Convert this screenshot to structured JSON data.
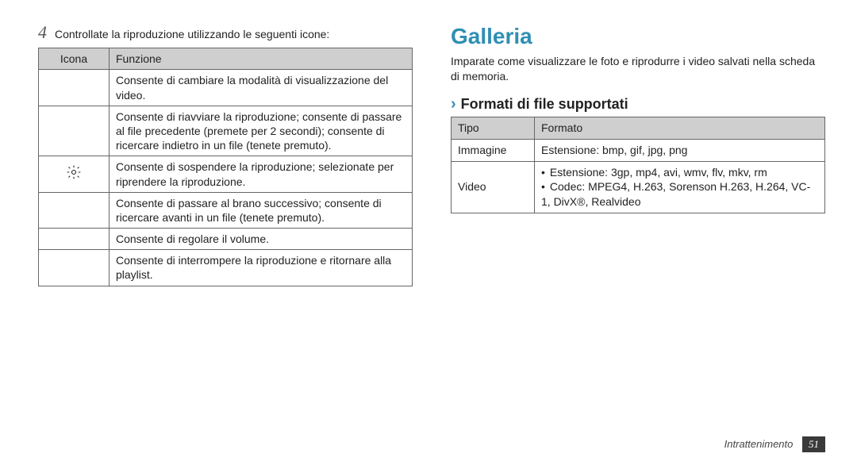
{
  "left": {
    "step_number": "4",
    "step_text": "Controllate la riproduzione utilizzando le seguenti icone:",
    "table": {
      "headers": [
        "Icona",
        "Funzione"
      ],
      "rows": [
        {
          "icon": "",
          "desc": "Consente di cambiare la modalità di visualizzazione del video."
        },
        {
          "icon": "",
          "desc": "Consente di riavviare la riproduzione; consente di passare al file precedente (premete per 2 secondi); consente di ricercare indietro in un file (tenete premuto)."
        },
        {
          "icon": "gear",
          "desc": "Consente di sospendere la riproduzione; selezionate          per riprendere la riproduzione."
        },
        {
          "icon": "",
          "desc": "Consente di passare al brano successivo; consente di ricercare avanti in un file (tenete premuto)."
        },
        {
          "icon": "",
          "desc": "Consente di regolare il volume."
        },
        {
          "icon": "",
          "desc": "Consente di interrompere la riproduzione e ritornare alla playlist."
        }
      ]
    }
  },
  "right": {
    "title": "Galleria",
    "intro": "Imparate come visualizzare le foto e riprodurre i video salvati nella scheda di memoria.",
    "subheading": "Formati di file supportati",
    "table": {
      "headers": [
        "Tipo",
        "Formato"
      ],
      "rows": [
        {
          "type": "Immagine",
          "format_single": "Estensione: bmp, gif, jpg, png"
        },
        {
          "type": "Video",
          "format_bullets": [
            "Estensione: 3gp, mp4, avi, wmv, flv, mkv, rm",
            "Codec: MPEG4, H.263, Sorenson H.263, H.264, VC-1, DivX®, Realvideo"
          ]
        }
      ]
    }
  },
  "footer": {
    "section": "Intrattenimento",
    "page": "51"
  }
}
